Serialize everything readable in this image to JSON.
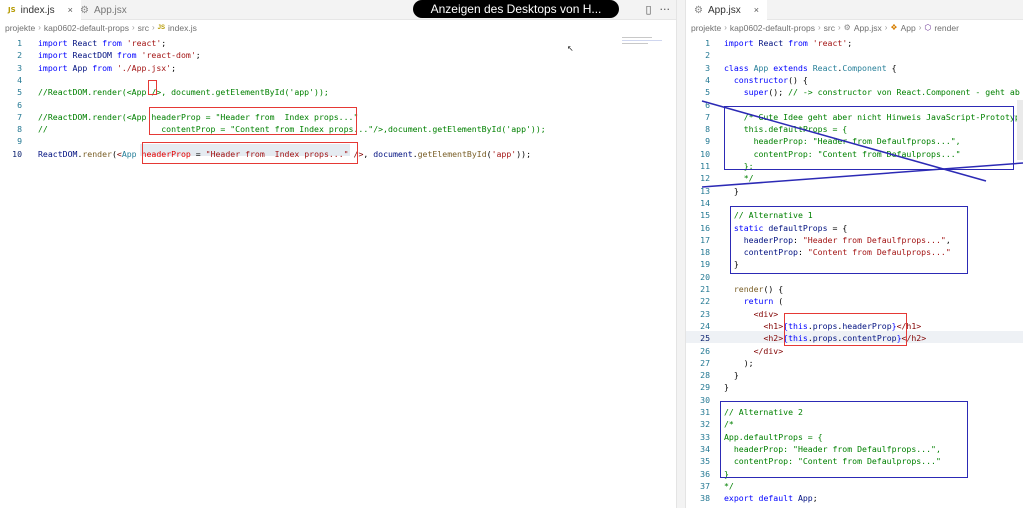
{
  "overlay": {
    "text": "Anzeigen des Desktops von H..."
  },
  "left": {
    "tab": {
      "icon": "JS",
      "label": "index.js",
      "close": "×"
    },
    "tab2": {
      "label": "App.jsx"
    },
    "actions": {
      "split": "▯",
      "more": "···"
    },
    "breadcrumb": [
      "projekte",
      "kap0602-default-props",
      "src",
      "index.js"
    ],
    "breadcrumb_sep": "›",
    "lines": {
      "l1": {
        "n": "1",
        "t": [
          [
            "kw",
            "import "
          ],
          [
            "vr",
            "React "
          ],
          [
            "kw",
            "from "
          ],
          [
            "str",
            "'react'"
          ],
          [
            "",
            "; "
          ]
        ]
      },
      "l2": {
        "n": "2",
        "t": [
          [
            "kw",
            "import "
          ],
          [
            "vr",
            "ReactDOM "
          ],
          [
            "kw",
            "from "
          ],
          [
            "str",
            "'react-dom'"
          ],
          [
            "",
            ";"
          ]
        ]
      },
      "l3": {
        "n": "3",
        "t": [
          [
            "kw",
            "import "
          ],
          [
            "vr",
            "App "
          ],
          [
            "kw",
            "from "
          ],
          [
            "str",
            "'./App.jsx'"
          ],
          [
            "",
            ";"
          ]
        ]
      },
      "l4": {
        "n": "4",
        "t": []
      },
      "l5": {
        "n": "5",
        "t": [
          [
            "cm",
            "//ReactDOM.render(<App />, document.getElementById('app'));"
          ]
        ]
      },
      "l6": {
        "n": "6",
        "t": []
      },
      "l7": {
        "n": "7",
        "t": [
          [
            "cm",
            "//ReactDOM.render(<App headerProp = \"Header from  Index props...\""
          ]
        ]
      },
      "l8": {
        "n": "8",
        "t": [
          [
            "cm",
            "//                       contentProp = \"Content from Index props...\"/>,document.getElementById('app'));"
          ]
        ]
      },
      "l9": {
        "n": "9",
        "t": []
      },
      "l10": {
        "n": "10",
        "t": [
          [
            "vr",
            "ReactDOM"
          ],
          [
            "",
            "."
          ],
          [
            "fn",
            "render"
          ],
          [
            "",
            "("
          ],
          [
            "tag",
            "<"
          ],
          [
            "ty",
            "App "
          ],
          [
            "attr",
            "headerProp "
          ],
          [
            "",
            "= "
          ],
          [
            "str",
            "\"Header from  Index props...\" "
          ],
          [
            "tag",
            "/>"
          ],
          [
            "",
            ", "
          ],
          [
            "vr",
            "document"
          ],
          [
            "",
            "."
          ],
          [
            "fn",
            "getElementById"
          ],
          [
            "",
            "("
          ],
          [
            "str",
            "'app'"
          ],
          [
            "",
            "));"
          ]
        ]
      }
    }
  },
  "right": {
    "tab": {
      "label": "App.jsx",
      "close": "×"
    },
    "breadcrumb": [
      "projekte",
      "kap0602-default-props",
      "src",
      "App.jsx",
      "App",
      "render"
    ],
    "breadcrumb_sep": "›",
    "lines": {
      "r1": {
        "n": "1",
        "t": [
          [
            "kw",
            "import "
          ],
          [
            "vr",
            "React "
          ],
          [
            "kw",
            "from "
          ],
          [
            "str",
            "'react'"
          ],
          [
            "",
            ";"
          ]
        ]
      },
      "r2": {
        "n": "2",
        "t": []
      },
      "r3": {
        "n": "3",
        "t": [
          [
            "kw",
            "class "
          ],
          [
            "ty",
            "App "
          ],
          [
            "kw",
            "extends "
          ],
          [
            "ty",
            "React"
          ],
          [
            "",
            "."
          ],
          [
            "ty",
            "Component "
          ],
          [
            "",
            "{"
          ]
        ]
      },
      "r4": {
        "n": "4",
        "t": [
          [
            "",
            "  "
          ],
          [
            "kw",
            "constructor"
          ],
          [
            "",
            "() {"
          ]
        ]
      },
      "r5": {
        "n": "5",
        "t": [
          [
            "",
            "    "
          ],
          [
            "kw",
            "super"
          ],
          [
            "",
            "(); "
          ],
          [
            "cm",
            "// -> constructor von React.Component - geht ab"
          ]
        ]
      },
      "r6": {
        "n": "6",
        "t": []
      },
      "r7": {
        "n": "7",
        "t": [
          [
            "",
            "    "
          ],
          [
            "cm",
            "/* Gute Idee geht aber nicht Hinweis JavaScript-Prototyp"
          ]
        ]
      },
      "r8": {
        "n": "8",
        "t": [
          [
            "cm",
            "    this.defaultProps = {"
          ]
        ]
      },
      "r9": {
        "n": "9",
        "t": [
          [
            "cm",
            "      headerProp: \"Header from Defaulfprops...\","
          ]
        ]
      },
      "r10": {
        "n": "10",
        "t": [
          [
            "cm",
            "      contentProp: \"Content from Defaulprops...\""
          ]
        ]
      },
      "r11": {
        "n": "11",
        "t": [
          [
            "cm",
            "    };"
          ]
        ]
      },
      "r12": {
        "n": "12",
        "t": [
          [
            "cm",
            "    */"
          ]
        ]
      },
      "r13": {
        "n": "13",
        "t": [
          [
            "",
            "  }"
          ]
        ]
      },
      "r14": {
        "n": "14",
        "t": []
      },
      "r15": {
        "n": "15",
        "t": [
          [
            "",
            "  "
          ],
          [
            "cm",
            "// Alternative 1"
          ]
        ]
      },
      "r16": {
        "n": "16",
        "t": [
          [
            "",
            "  "
          ],
          [
            "kw",
            "static "
          ],
          [
            "vr",
            "defaultProps "
          ],
          [
            "",
            "= {"
          ]
        ]
      },
      "r17": {
        "n": "17",
        "t": [
          [
            "",
            "    "
          ],
          [
            "vr",
            "headerProp"
          ],
          [
            ": "
          ],
          [
            "str",
            "\"Header from Defaulfprops...\""
          ],
          [
            "",
            ","
          ]
        ]
      },
      "r18": {
        "n": "18",
        "t": [
          [
            "",
            "    "
          ],
          [
            "vr",
            "contentProp"
          ],
          [
            ": "
          ],
          [
            "str",
            "\"Content from Defaulprops...\""
          ]
        ]
      },
      "r19": {
        "n": "19",
        "t": [
          [
            "",
            "  }"
          ]
        ]
      },
      "r20": {
        "n": "20",
        "t": []
      },
      "r21": {
        "n": "21",
        "t": [
          [
            "",
            "  "
          ],
          [
            "fn",
            "render"
          ],
          [
            "",
            "() {"
          ]
        ]
      },
      "r22": {
        "n": "22",
        "t": [
          [
            "",
            "    "
          ],
          [
            "kw",
            "return "
          ],
          [
            "",
            "("
          ]
        ]
      },
      "r23": {
        "n": "23",
        "t": [
          [
            "",
            "      "
          ],
          [
            "tag",
            "<div>"
          ]
        ]
      },
      "r24": {
        "n": "24",
        "t": [
          [
            "",
            "        "
          ],
          [
            "tag",
            "<h1>"
          ],
          [
            "kw",
            "{"
          ],
          [
            "kw",
            "this"
          ],
          [
            "",
            "."
          ],
          [
            "vr",
            "props"
          ],
          [
            "",
            "."
          ],
          [
            "vr",
            "headerProp"
          ],
          [
            "kw",
            "}"
          ],
          [
            "tag",
            "</h1>"
          ]
        ]
      },
      "r25": {
        "n": "25",
        "t": [
          [
            "",
            "        "
          ],
          [
            "tag",
            "<h2>"
          ],
          [
            "kw",
            "{"
          ],
          [
            "kw",
            "this"
          ],
          [
            "",
            "."
          ],
          [
            "vr",
            "props"
          ],
          [
            "",
            "."
          ],
          [
            "vr",
            "contentProp"
          ],
          [
            "kw",
            "}"
          ],
          [
            "tag",
            "</h2>"
          ]
        ]
      },
      "r26": {
        "n": "26",
        "t": [
          [
            "",
            "      "
          ],
          [
            "tag",
            "</div>"
          ]
        ]
      },
      "r27": {
        "n": "27",
        "t": [
          [
            "",
            "    );"
          ]
        ]
      },
      "r28": {
        "n": "28",
        "t": [
          [
            "",
            "  }"
          ]
        ]
      },
      "r29": {
        "n": "29",
        "t": [
          [
            "",
            "}"
          ]
        ]
      },
      "r30": {
        "n": "30",
        "t": []
      },
      "r31": {
        "n": "31",
        "t": [
          [
            "cm",
            "// Alternative 2"
          ]
        ]
      },
      "r32": {
        "n": "32",
        "t": [
          [
            "cm",
            "/*"
          ]
        ]
      },
      "r33": {
        "n": "33",
        "t": [
          [
            "cm",
            "App.defaultProps = {"
          ]
        ]
      },
      "r34": {
        "n": "34",
        "t": [
          [
            "cm",
            "  headerProp: \"Header from Defaulfprops...\","
          ]
        ]
      },
      "r35": {
        "n": "35",
        "t": [
          [
            "cm",
            "  contentProp: \"Content from Defaulprops...\""
          ]
        ]
      },
      "r36": {
        "n": "36",
        "t": [
          [
            "cm",
            "}"
          ]
        ]
      },
      "r37": {
        "n": "37",
        "t": [
          [
            "cm",
            "*/"
          ]
        ]
      },
      "r38": {
        "n": "38",
        "t": [
          [
            "kw",
            "export "
          ],
          [
            "kw",
            "default "
          ],
          [
            "vr",
            "App"
          ],
          [
            "",
            ";"
          ]
        ]
      }
    }
  },
  "colors": {
    "red_highlight": "#e53935",
    "blue_highlight": "#2c2ab5"
  }
}
